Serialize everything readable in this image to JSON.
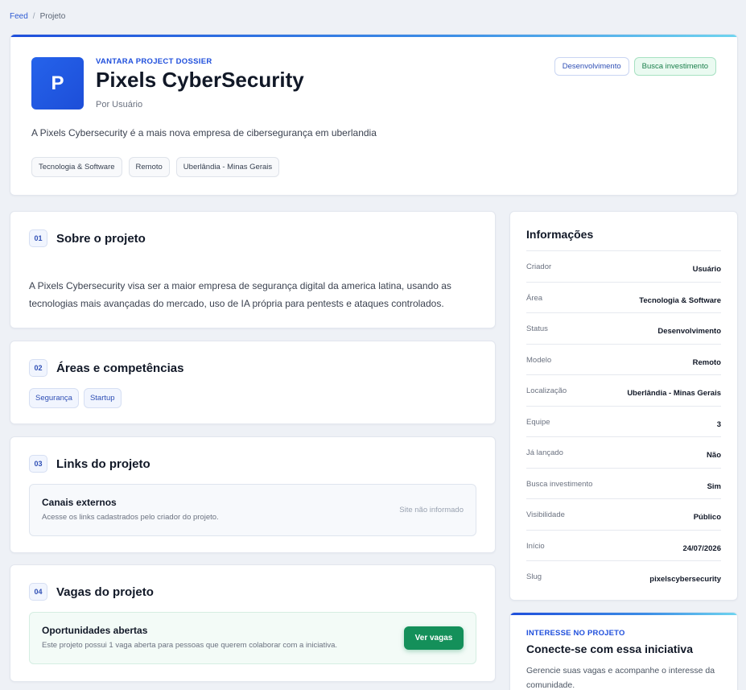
{
  "breadcrumb": {
    "root": "Feed",
    "separator": "/",
    "current": "Projeto"
  },
  "hero": {
    "logo_letter": "P",
    "kicker": "VANTARA PROJECT DOSSIER",
    "title": "Pixels CyberSecurity",
    "byline": "Por Usuário",
    "status_badges": [
      "Desenvolvimento",
      "Busca investimento"
    ],
    "description": "A Pixels Cybersecurity é a mais nova empresa de cibersegurança em uberlandia",
    "chips": [
      "Tecnologia & Software",
      "Remoto",
      "Uberlândia - Minas Gerais"
    ]
  },
  "sections": {
    "about": {
      "number": "01",
      "title": "Sobre o projeto",
      "text": "A Pixels Cybersecurity visa ser a maior empresa de segurança digital da america latina, usando as tecnologias mais avançadas do mercado, uso de IA própria para pentests e ataques controlados."
    },
    "areas": {
      "number": "02",
      "title": "Áreas e competências",
      "tags": [
        "Segurança",
        "Startup"
      ]
    },
    "links": {
      "number": "03",
      "title": "Links do projeto",
      "box_title": "Canais externos",
      "box_subtitle": "Acesse os links cadastrados pelo criador do projeto.",
      "box_status": "Site não informado"
    },
    "jobs": {
      "number": "04",
      "title": "Vagas do projeto",
      "box_title": "Oportunidades abertas",
      "box_subtitle": "Este projeto possui 1 vaga aberta para pessoas que querem colaborar com a iniciativa.",
      "button_label": "Ver vagas"
    }
  },
  "info": {
    "title": "Informações",
    "rows": [
      {
        "label": "Criador",
        "value": "Usuário"
      },
      {
        "label": "Área",
        "value": "Tecnologia & Software"
      },
      {
        "label": "Status",
        "value": "Desenvolvimento"
      },
      {
        "label": "Modelo",
        "value": "Remoto"
      },
      {
        "label": "Localização",
        "value": "Uberlândia - Minas Gerais"
      },
      {
        "label": "Equipe",
        "value": "3"
      },
      {
        "label": "Já lançado",
        "value": "Não"
      },
      {
        "label": "Busca investimento",
        "value": "Sim"
      },
      {
        "label": "Visibilidade",
        "value": "Público"
      },
      {
        "label": "Início",
        "value": "24/07/2026"
      },
      {
        "label": "Slug",
        "value": "pixelscybersecurity"
      }
    ]
  },
  "interest": {
    "kicker": "INTERESSE NO PROJETO",
    "title": "Conecte-se com essa iniciativa",
    "description": "Gerencie suas vagas e acompanhe o interesse da comunidade."
  },
  "colors": {
    "accent": "#1f4fdc",
    "success": "#14905a",
    "background": "#eef1f6"
  }
}
